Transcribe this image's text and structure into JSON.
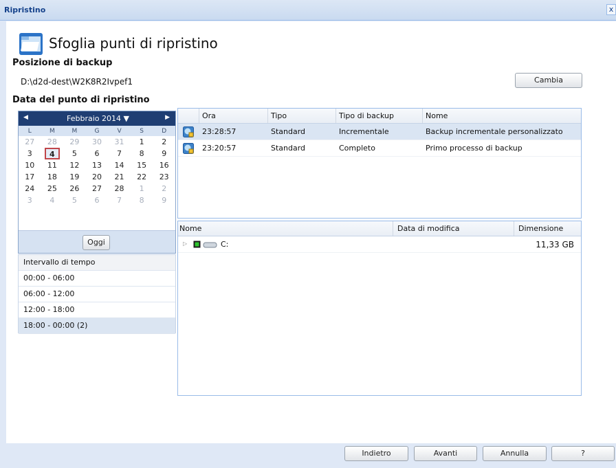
{
  "window": {
    "title": "Ripristino",
    "close_label": "x"
  },
  "header": {
    "title": "Sfoglia punti di ripristino"
  },
  "backup_location": {
    "label": "Posizione di backup",
    "path": "D:\\d2d-dest\\W2K8R2Ivpef1",
    "change_button": "Cambia"
  },
  "recovery_date": {
    "label": "Data del punto di ripristino"
  },
  "calendar": {
    "month_label": "Febbraio 2014",
    "weekdays": [
      "L",
      "M",
      "M",
      "G",
      "V",
      "S",
      "D"
    ],
    "weeks": [
      [
        "27",
        "28",
        "29",
        "30",
        "31",
        "1",
        "2"
      ],
      [
        "3",
        "4",
        "5",
        "6",
        "7",
        "8",
        "9"
      ],
      [
        "10",
        "11",
        "12",
        "13",
        "14",
        "15",
        "16"
      ],
      [
        "17",
        "18",
        "19",
        "20",
        "21",
        "22",
        "23"
      ],
      [
        "24",
        "25",
        "26",
        "27",
        "28",
        "1",
        "2"
      ],
      [
        "3",
        "4",
        "5",
        "6",
        "7",
        "8",
        "9"
      ]
    ],
    "today_button": "Oggi",
    "selected_day": "4"
  },
  "time_interval": {
    "header": "Intervallo di tempo",
    "rows": [
      "00:00 - 06:00",
      "06:00 - 12:00",
      "12:00 - 18:00",
      "18:00 - 00:00 (2)"
    ],
    "selected_index": 3
  },
  "backup_grid": {
    "columns": {
      "time": "Ora",
      "type": "Tipo",
      "backup_type": "Tipo di backup",
      "name": "Nome"
    },
    "rows": [
      {
        "time": "23:28:57",
        "type": "Standard",
        "backup_type": "Incrementale",
        "name": "Backup incrementale personalizzato",
        "selected": true
      },
      {
        "time": "23:20:57",
        "type": "Standard",
        "backup_type": "Completo",
        "name": "Primo processo di backup",
        "selected": false
      }
    ]
  },
  "file_grid": {
    "columns": {
      "name": "Nome",
      "modified": "Data di modifica",
      "size": "Dimensione"
    },
    "rows": [
      {
        "name": "C:",
        "modified": "",
        "size": "11,33 GB"
      }
    ]
  },
  "footer": {
    "back": "Indietro",
    "next": "Avanti",
    "cancel": "Annulla",
    "help": "?"
  },
  "colors": {
    "calendar_header": "#1f3e73",
    "selection": "#dae5f3",
    "today_border": "#c0454a",
    "frame_blue": "#99bbe8"
  }
}
